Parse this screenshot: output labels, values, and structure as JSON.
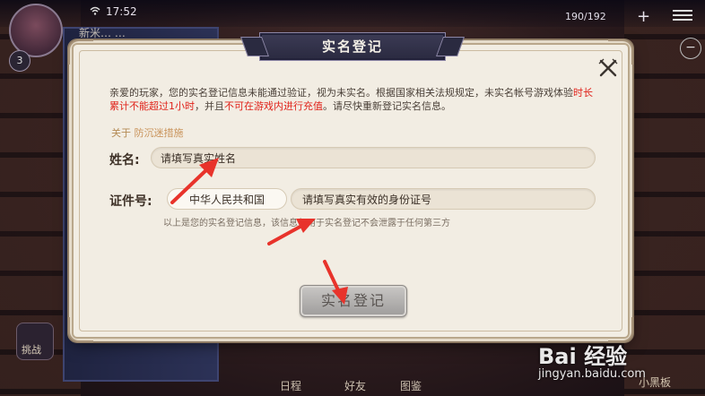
{
  "status_bar": {
    "time": "17:52"
  },
  "hud": {
    "level": "3",
    "player_name": "新米… …",
    "energy": "190/192",
    "plus": "+",
    "minus": "−"
  },
  "dialog": {
    "title": "实名登记",
    "notice_part1": "亲爱的玩家，您的实名登记信息未能通过验证，视为未实名。根据国家相关法规规定，未实名帐号游戏体验",
    "notice_warn1": "时长累计不能超过1小时",
    "notice_part2": "，并且",
    "notice_warn2": "不可在游戏内进行充值",
    "notice_part3": "。请尽快重新登记实名信息。",
    "anti_prefix": "关于",
    "anti_link": "防沉迷措施",
    "name_label": "姓名:",
    "name_placeholder": "请填写真实姓名",
    "id_label": "证件号:",
    "id_region": "中华人民共和国",
    "id_placeholder": "请填写真实有效的身份证号",
    "privacy_note": "以上是您的实名登记信息，该信息仅用于实名登记不会泄露于任何第三方",
    "submit_label": "实名登记"
  },
  "bottom_nav": {
    "item1": "日程",
    "item2": "好友",
    "item3": "图鉴",
    "board": "小黑板",
    "left_label": "挑战"
  },
  "watermark": {
    "brand": "Bai 经验",
    "url": "jingyan.baidu.com"
  },
  "colors": {
    "warning_red": "#e0231b",
    "link_gold": "#c9935a",
    "banner": "#2e2d45",
    "annotation_red": "#e8332b"
  }
}
